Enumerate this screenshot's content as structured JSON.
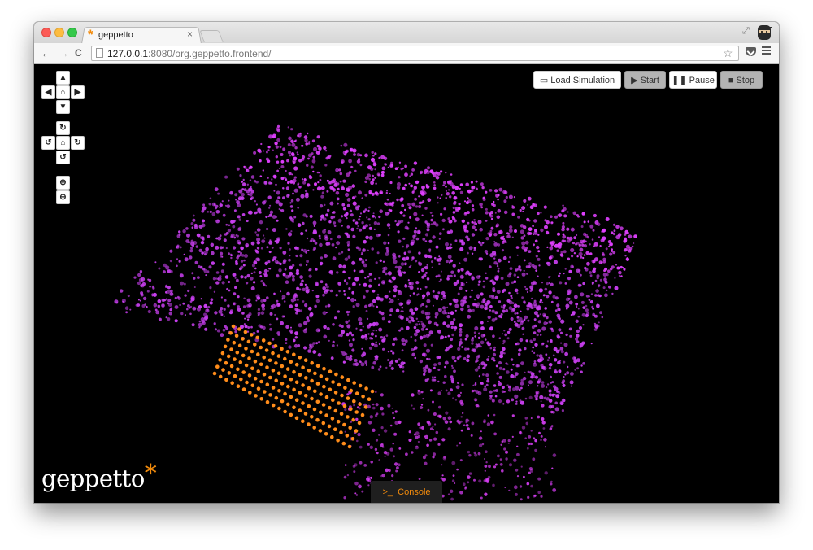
{
  "browser": {
    "tab_title": "geppetto",
    "tab_close": "×",
    "tab_favicon": "*",
    "url_host": "127.0.0.1",
    "url_rest": ":8080/org.geppetto.frontend/",
    "back_icon": "←",
    "forward_icon": "→",
    "reload_icon": "C",
    "star_icon": "☆",
    "fullscreen_icon": "⤢"
  },
  "camera_controls": {
    "pan_up": "▲",
    "pan_left": "◀",
    "pan_home": "⌂",
    "pan_right": "▶",
    "pan_down": "▼",
    "rotate_up": "↻",
    "rotate_left": "↺",
    "rotate_home": "⌂",
    "rotate_right": "↻",
    "rotate_down": "↺",
    "zoom_in": "⊕",
    "zoom_out": "⊖"
  },
  "simulation_controls": {
    "load_label": "Load Simulation",
    "load_icon": "▭",
    "start_label": "Start",
    "start_icon": "▶",
    "pause_label": "Pause",
    "pause_icon": "❚❚",
    "stop_label": "Stop",
    "stop_icon": "■"
  },
  "logo": {
    "text": "geppetto",
    "star": "*"
  },
  "console": {
    "icon": ">_",
    "label": "Console"
  },
  "colors": {
    "accent": "#f28b0c",
    "particle_purple": "#c93ff0",
    "particle_magenta": "#e040ff",
    "particle_orange": "#ff8c1a"
  }
}
